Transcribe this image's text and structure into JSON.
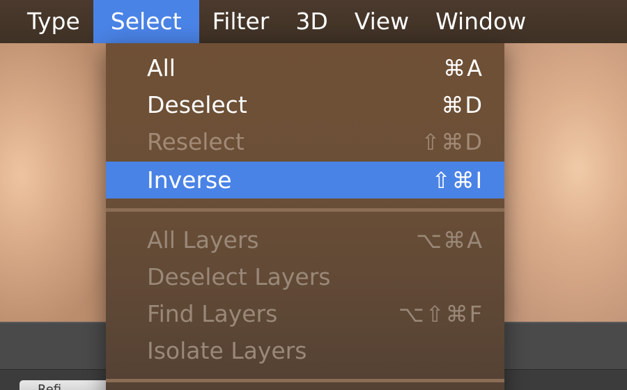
{
  "menubar": {
    "items": [
      {
        "label": "Type"
      },
      {
        "label": "Select"
      },
      {
        "label": "Filter"
      },
      {
        "label": "3D"
      },
      {
        "label": "View"
      },
      {
        "label": "Window"
      }
    ],
    "active": "Select"
  },
  "select_menu": {
    "items": [
      {
        "label": "All",
        "shortcut": "⌘A",
        "enabled": true
      },
      {
        "label": "Deselect",
        "shortcut": "⌘D",
        "enabled": true
      },
      {
        "label": "Reselect",
        "shortcut": "⇧⌘D",
        "enabled": false
      },
      {
        "label": "Inverse",
        "shortcut": "⇧⌘I",
        "enabled": true,
        "highlighted": true
      },
      {
        "label": "All Layers",
        "shortcut": "⌥⌘A",
        "enabled": false
      },
      {
        "label": "Deselect Layers",
        "shortcut": "",
        "enabled": false
      },
      {
        "label": "Find Layers",
        "shortcut": "⌥⇧⌘F",
        "enabled": false
      },
      {
        "label": "Isolate Layers",
        "shortcut": "",
        "enabled": false
      }
    ]
  },
  "bottom_panel": {
    "button_label": "Refi"
  },
  "colors": {
    "menubar_bg": "#45352a",
    "menu_bg": "#6b4f37",
    "highlight": "#4a83e6",
    "disabled_text": "#a18a76"
  }
}
